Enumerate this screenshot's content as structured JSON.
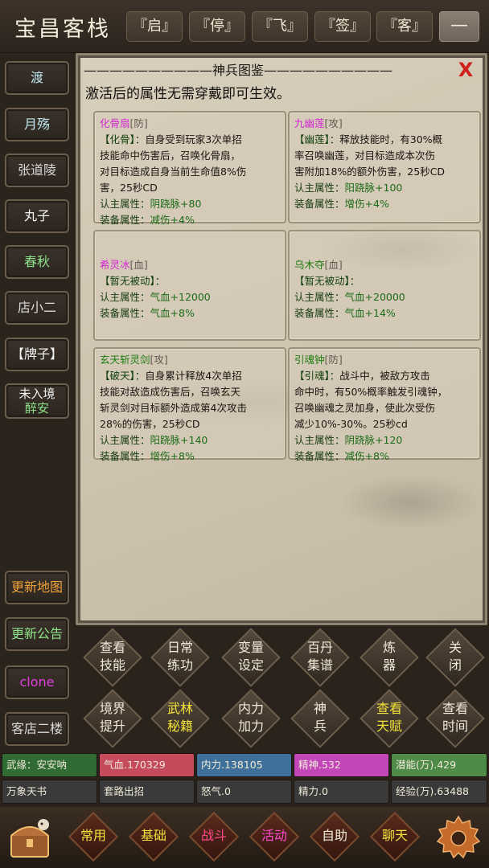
{
  "header": {
    "title": "宝昌客栈",
    "buttons": [
      "『启』",
      "『停』",
      "『飞』",
      "『签』",
      "『客』"
    ],
    "minimize": "—"
  },
  "sidebar": {
    "items": [
      {
        "label": "渡",
        "color": "#bfe8f0"
      },
      {
        "label": "月殇",
        "color": "#bfe8f0"
      },
      {
        "label": "张道陵",
        "color": "#d8d8d8"
      },
      {
        "label": "丸子",
        "color": "#f2f2f2"
      },
      {
        "label": "春秋",
        "color": "#8ee48a"
      },
      {
        "label": "店小二",
        "color": "#d8d8d8"
      },
      {
        "label": "【牌子】",
        "color": "#f2f2f2"
      },
      {
        "label": "未入境",
        "label2": "醉安",
        "color": "#f2f2f2",
        "color2": "#8ee48a"
      }
    ],
    "bottom_items": [
      {
        "label": "更新地图",
        "color": "#f0a23a"
      },
      {
        "label": "更新公告",
        "color": "#8ee48a"
      },
      {
        "label": "clone",
        "color": "#e040e0"
      },
      {
        "label": "客店二楼",
        "color": "#d8d8d8"
      }
    ]
  },
  "panel": {
    "title": "——————————神兵图鉴——————————",
    "close": "X",
    "subtitle": "激活后的属性无需穿戴即可生效。",
    "cards": [
      {
        "name": "化骨扇",
        "name_color": "#d326d3",
        "type": "[防]",
        "skill_title": "【化骨】：",
        "desc": [
          "自身受到玩家3次单招",
          "技能命中伤害后，召唤化骨扇，",
          "对目标造成自身当前生命值8%伤",
          "害，25秒CD"
        ],
        "attr1_label": "认主属性：",
        "attr1_value": "阴跷脉+80",
        "attr2_label": "装备属性：",
        "attr2_value": "减伤+4%"
      },
      {
        "name": "九幽莲",
        "name_color": "#d326d3",
        "type": "[攻]",
        "skill_title": "【幽莲】：",
        "desc": [
          "释放技能时，有30%概",
          "率召唤幽莲，对目标造成本次伤",
          "害附加18%的额外伤害，25秒CD"
        ],
        "attr1_label": "认主属性：",
        "attr1_value": "阳跷脉+100",
        "attr2_label": "装备属性：",
        "attr2_value": "增伤+4%"
      },
      {
        "name": "希灵冰",
        "name_color": "#d326d3",
        "type": "[血]",
        "skill_title": "【暂无被动】：",
        "desc": [],
        "attr1_label": "认主属性：",
        "attr1_value": "气血+12000",
        "attr2_label": "装备属性：",
        "attr2_value": "气血+8%"
      },
      {
        "name": "乌木夺",
        "name_color": "#1d7d12",
        "type": "[血]",
        "skill_title": "【暂无被动】：",
        "desc": [],
        "attr1_label": "认主属性：",
        "attr1_value": "气血+20000",
        "attr2_label": "装备属性：",
        "attr2_value": "气血+14%"
      },
      {
        "name": "玄天斩灵剑",
        "name_color": "#1d7d12",
        "type": "[攻]",
        "skill_title": "【破天】：",
        "desc": [
          "自身累计释放4次单招",
          "技能对敌造成伤害后，召唤玄天",
          "斩灵剑对目标额外造成第4次攻击",
          "28%的伤害，25秒CD"
        ],
        "attr1_label": "认主属性：",
        "attr1_value": "阳跷脉+140",
        "attr2_label": "装备属性：",
        "attr2_value": "增伤+8%"
      },
      {
        "name": "引魂钟",
        "name_color": "#1d7d12",
        "type": "[防]",
        "skill_title": "【引魂】：",
        "desc": [
          "战斗中，被敌方攻击",
          "命中时，有50%概率触发引魂钟，",
          "召唤幽魂之灵加身，使此次受伤",
          "减少10%-30%。25秒cd"
        ],
        "attr1_label": "认主属性：",
        "attr1_value": "阴跷脉+120",
        "attr2_label": "装备属性：",
        "attr2_value": "减伤+8%"
      }
    ]
  },
  "menu": {
    "row1": [
      {
        "l1": "查看",
        "l2": "技能",
        "color": "#f1ead7"
      },
      {
        "l1": "日常",
        "l2": "练功",
        "color": "#f1ead7"
      },
      {
        "l1": "变量",
        "l2": "设定",
        "color": "#f1ead7"
      },
      {
        "l1": "百丹",
        "l2": "集谱",
        "color": "#f1ead7"
      },
      {
        "l1": "炼",
        "l2": "器",
        "color": "#f1ead7"
      },
      {
        "l1": "关",
        "l2": "闭",
        "color": "#f1ead7"
      }
    ],
    "row2": [
      {
        "l1": "境界",
        "l2": "提升",
        "color": "#f1ead7"
      },
      {
        "l1": "武林",
        "l2": "秘籍",
        "color": "#f2e23a"
      },
      {
        "l1": "内力",
        "l2": "加力",
        "color": "#f1ead7"
      },
      {
        "l1": "神",
        "l2": "兵",
        "color": "#f1ead7"
      },
      {
        "l1": "查看",
        "l2": "天赋",
        "color": "#f2e23a"
      },
      {
        "l1": "查看",
        "l2": "时间",
        "color": "#f1ead7"
      }
    ]
  },
  "stats": {
    "row1": [
      {
        "text": "武缘：安安呐",
        "bg": "#2f6b33"
      },
      {
        "text": "气血.170329",
        "bg": "#c44a5c"
      },
      {
        "text": "内力.138105",
        "bg": "#3f7099"
      },
      {
        "text": "精神.532",
        "bg": "#c346b9"
      },
      {
        "text": "潜能(万).429",
        "bg": "#4e8a48"
      }
    ],
    "row2": [
      {
        "text": "万象天书",
        "bg": "#3a3a3a"
      },
      {
        "text": "套路出招",
        "bg": "#3a3a3a"
      },
      {
        "text": "怒气.0",
        "bg": "#3a3a3a"
      },
      {
        "text": "精力.0",
        "bg": "#3a3a3a"
      },
      {
        "text": "经验(万).63488",
        "bg": "#3a3a3a"
      }
    ]
  },
  "bottom_nav": [
    {
      "label": "常用",
      "color": "#f2e23a"
    },
    {
      "label": "基础",
      "color": "#f2e23a"
    },
    {
      "label": "战斗",
      "color": "#ff4a8a"
    },
    {
      "label": "活动",
      "color": "#ff4ad0"
    },
    {
      "label": "自助",
      "color": "#f1ead7"
    },
    {
      "label": "聊天",
      "color": "#f2e23a"
    }
  ]
}
